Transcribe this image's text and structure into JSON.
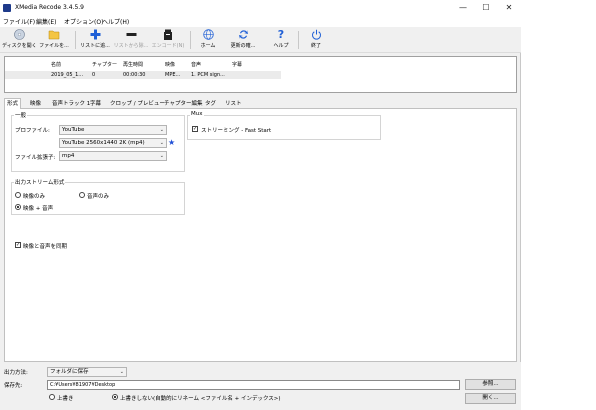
{
  "window": {
    "title": "XMedia Recode 3.4.5.9",
    "minimize": "—",
    "maximize": "☐",
    "close": "✕"
  },
  "menu": [
    "ファイル(F)",
    "編集(E)",
    "オプション(O)",
    "ヘルプ(H)"
  ],
  "toolbar": {
    "open_disc": "ディスクを開く",
    "open_file": "ファイルを...",
    "add_to_list": "リストに追...",
    "remove_from_list": "リストから除...",
    "encode": "エンコード(N)",
    "home": "ホーム",
    "check_updates": "更新の確...",
    "help": "ヘルプ",
    "exit": "終了",
    "icons": {
      "open_disc": "disc-icon",
      "open_file": "folder-icon",
      "add_to_list": "plus-icon",
      "remove_from_list": "minus-icon",
      "encode": "encode-icon",
      "home": "globe-icon",
      "check_updates": "refresh-icon",
      "help": "question-icon",
      "exit": "power-icon"
    }
  },
  "file_list": {
    "columns": [
      "名前",
      "チャプター",
      "再生時間",
      "映像",
      "音声",
      "字幕"
    ],
    "rows": [
      [
        "2019_05_1...",
        "0",
        "00:00:30",
        "MPE...",
        "1. PCM sign...",
        ""
      ]
    ]
  },
  "tabs": [
    "形式",
    "映像",
    "音声トラック 1",
    "字幕",
    "クロップ / プレビュー",
    "チャプター編集",
    "タグ",
    "リスト"
  ],
  "format": {
    "general_title": "一般",
    "profile_label": "プロファイル:",
    "profile_value": "YouTube",
    "preset_value": "YouTube 2560x1440 2K (mp4)",
    "ext_label": "ファイル拡張子:",
    "ext_value": "mp4",
    "mux_title": "Mux",
    "streaming_label": "ストリーミング - Fast Start",
    "streaming_checked": true,
    "output_stream_title": "出力ストリーム形式",
    "video_only": "映像のみ",
    "audio_only": "音声のみ",
    "video_audio": "映像 + 音声",
    "selected_stream": "video_audio",
    "sync_label": "映像と音声を同期",
    "sync_checked": true
  },
  "bottom": {
    "output_method_label": "出力方法:",
    "output_method_value": "フォルダに保存",
    "save_to_label": "保存先:",
    "save_path": "C:¥Users¥81907¥Desktop",
    "browse_button": "参照...",
    "overwrite_label": "上書き",
    "no_overwrite_label": "上書きしない(自動的にリネーム <ファイル名 + インデックス>)",
    "open_button": "開く...",
    "selected_write_mode": "no_overwrite"
  },
  "colors": {
    "accent_blue": "#1f4fd6",
    "window_bg": "#f0f0f0"
  }
}
